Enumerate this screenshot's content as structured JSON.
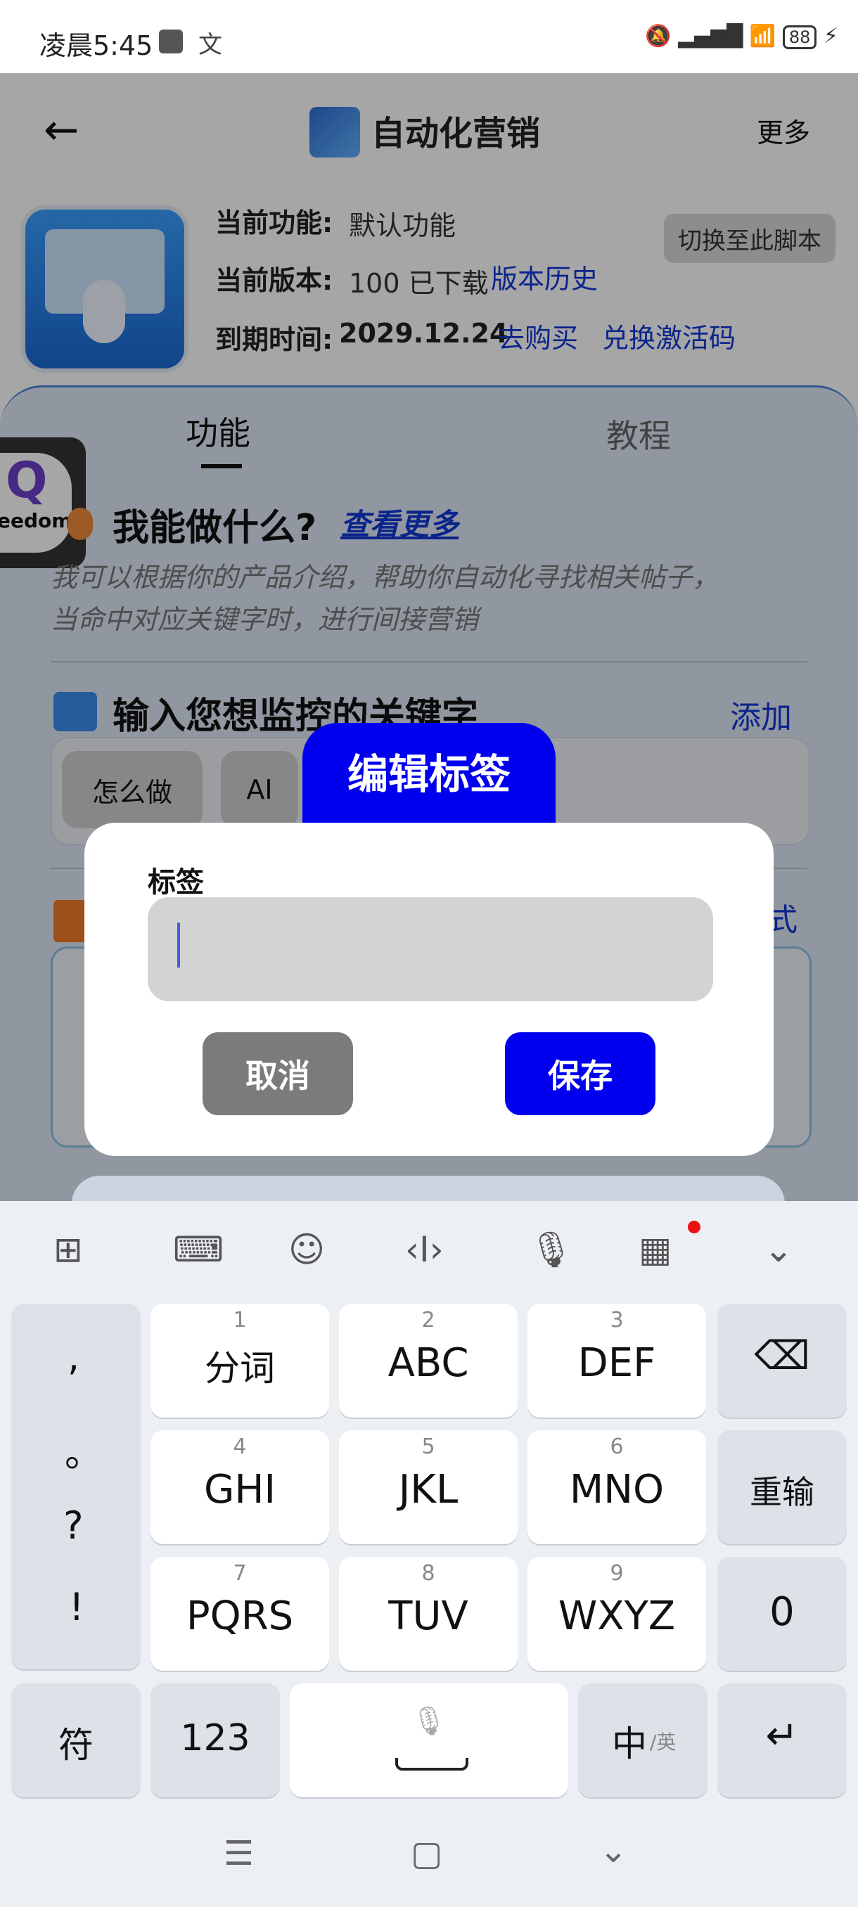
{
  "status_bar": {
    "time": "凌晨5:45",
    "ime_indicator": "文",
    "battery": "88"
  },
  "app_bar": {
    "title": "自动化营销",
    "more": "更多"
  },
  "info": {
    "feature_label": "当前功能:",
    "feature_value": "默认功能",
    "version_label": "当前版本:",
    "version_value": "100 已下载",
    "version_history": "版本历史",
    "expiry_label": "到期时间:",
    "expiry_value": "2029.12.24",
    "buy": "去购买",
    "redeem": "兑换激活码",
    "switch_button": "切换至此脚本"
  },
  "tabs": [
    "功能",
    "教程"
  ],
  "floating_badge": {
    "text": "eedom"
  },
  "section1": {
    "title": "我能做什么?",
    "link": "查看更多",
    "desc_line1": "我可以根据你的产品介绍，帮助你自动化寻找相关帖子，",
    "desc_line2": "当命中对应关键字时，进行间接营销"
  },
  "section2": {
    "title": "输入您想监控的关键字",
    "add": "添加",
    "chips": [
      "怎么做",
      "AI"
    ]
  },
  "section3": {
    "side_text_right": "式"
  },
  "dialog": {
    "tab_title": "编辑标签",
    "label": "标签",
    "input_value": "",
    "cancel": "取消",
    "save": "保存"
  },
  "keyboard": {
    "left_column": [
      ",",
      "。",
      "?",
      "!"
    ],
    "rows": [
      [
        {
          "num": "1",
          "label": "分词"
        },
        {
          "num": "2",
          "label": "ABC"
        },
        {
          "num": "3",
          "label": "DEF"
        }
      ],
      [
        {
          "num": "4",
          "label": "GHI"
        },
        {
          "num": "5",
          "label": "JKL"
        },
        {
          "num": "6",
          "label": "MNO"
        }
      ],
      [
        {
          "num": "7",
          "label": "PQRS"
        },
        {
          "num": "8",
          "label": "TUV"
        },
        {
          "num": "9",
          "label": "WXYZ"
        }
      ]
    ],
    "reenter": "重输",
    "zero": "0",
    "symbols": "符",
    "numbers": "123",
    "lang_main": "中",
    "lang_alt": "/英"
  },
  "colors": {
    "accent_blue": "#0000ee",
    "link_blue": "#1238d6"
  }
}
